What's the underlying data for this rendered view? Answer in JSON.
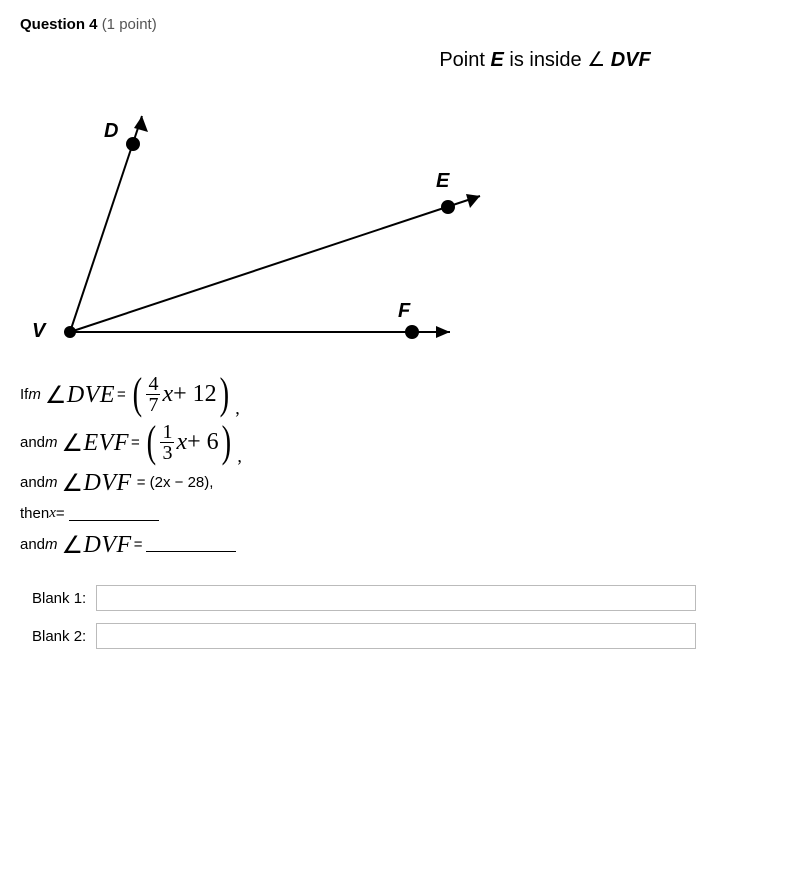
{
  "question": {
    "label": "Question 4",
    "points": "(1 point)"
  },
  "statement": {
    "prefix": "Point ",
    "point": "E",
    "mid": " is inside ",
    "angle": "DVF"
  },
  "figure": {
    "labels": {
      "D": "D",
      "E": "E",
      "F": "F",
      "V": "V"
    }
  },
  "lines": {
    "l1_prefix": "If ",
    "l1_m": "m",
    "l1_angle": "DVE",
    "l1_eq": " = ",
    "l1_frac_num": "4",
    "l1_frac_den": "7",
    "l1_var": "x",
    "l1_plus": " + 12",
    "l1_comma": ",",
    "l2_prefix": "and ",
    "l2_m": "m",
    "l2_angle": "EVF",
    "l2_eq": " = ",
    "l2_frac_num": "1",
    "l2_frac_den": "3",
    "l2_var": "x",
    "l2_plus": " + 6",
    "l2_comma": ",",
    "l3_prefix": "and ",
    "l3_m": "m",
    "l3_angle": "DVF",
    "l3_eq_expr": " = (2x − 28),",
    "l4_text_a": "then ",
    "l4_text_b": "x",
    "l4_text_c": " = ",
    "l5_prefix": "and ",
    "l5_m": "m",
    "l5_angle": "DVF",
    "l5_eq": " = "
  },
  "blanks": {
    "b1_label": "Blank 1:",
    "b2_label": "Blank 2:",
    "b1_value": "",
    "b2_value": ""
  }
}
